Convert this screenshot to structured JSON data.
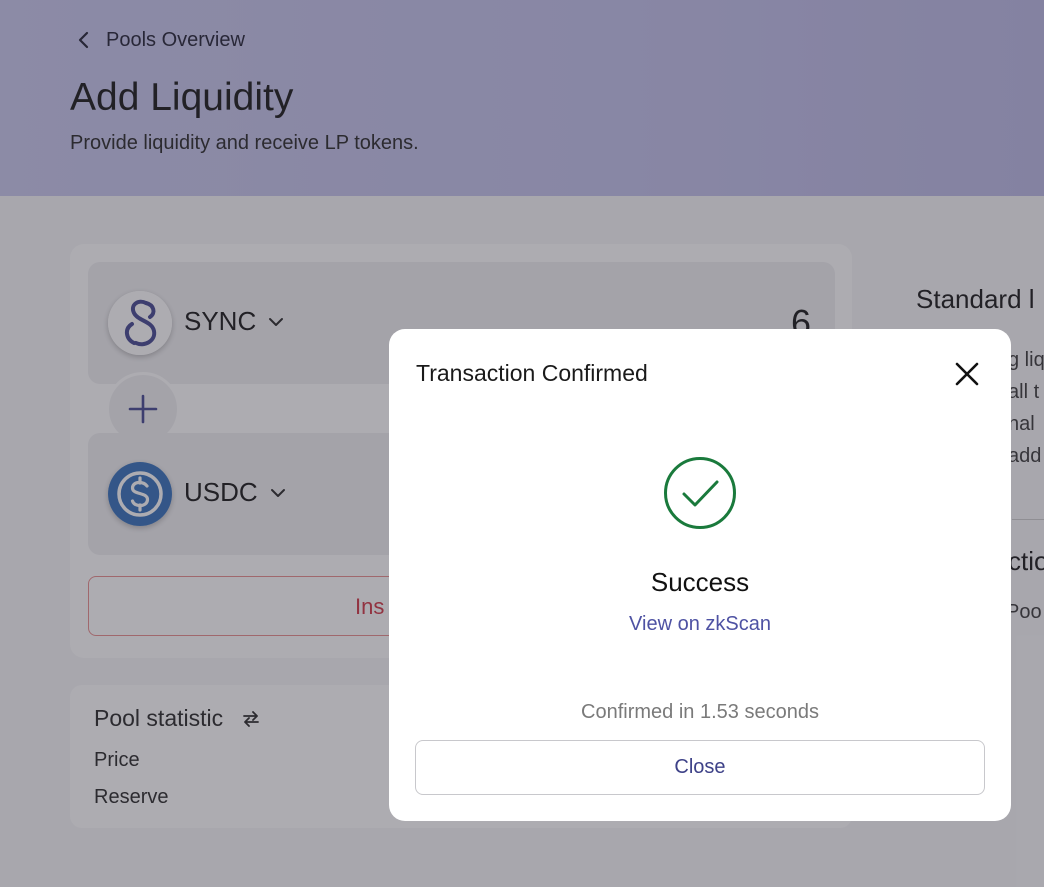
{
  "header": {
    "back_label": "Pools Overview",
    "title": "Add Liquidity",
    "subtitle": "Provide liquidity and receive LP tokens."
  },
  "form": {
    "token_a": {
      "symbol": "SYNC",
      "amount": "6",
      "icon": "sync-token-icon"
    },
    "token_b": {
      "symbol": "USDC",
      "icon": "usdc-token-icon"
    },
    "action_button_partial": "Ins"
  },
  "stats": {
    "title": "Pool statistic",
    "price_label": "Price",
    "reserve_label": "Reserve"
  },
  "right_panel": {
    "title": "Standard l",
    "lines": [
      "g liq",
      "all t",
      "nal",
      "add"
    ],
    "subheading": "ctio",
    "subline": "Poo"
  },
  "modal": {
    "title": "Transaction Confirmed",
    "status": "Success",
    "link_label": "View on zkScan",
    "confirmed_text": "Confirmed in 1.53 seconds",
    "close_label": "Close"
  },
  "colors": {
    "success_green": "#1a7a3c",
    "link_purple": "#4e52a3",
    "error_red": "#d0303e",
    "usdc_blue": "#2f6cb8"
  }
}
